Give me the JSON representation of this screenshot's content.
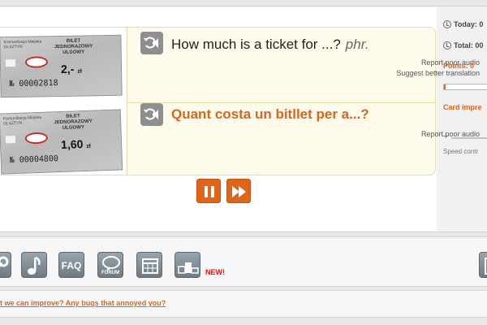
{
  "card": {
    "image_alt": "Bus ticket",
    "ticket_top": {
      "header": "Komunikacja Miejska OLSZTYN",
      "type": "BILET JEDNORAZOWY",
      "subtype": "ULGOWY",
      "price": "2,-",
      "price_unit": "zł",
      "number": "№ 00002818"
    },
    "ticket_bottom": {
      "header": "Komunikacja Miejska OLSZTYN",
      "type": "BILET JEDNORAZOWY",
      "subtype": "ULGOWY",
      "price": "1,60",
      "price_unit": "zł",
      "number": "№ 00004800"
    },
    "source_phrase": "How much is a ticket for ...?",
    "source_pos": "phr.",
    "target_phrase": "Quant costa un bitllet per a...?",
    "report_audio_label": "Report poor audio",
    "suggest_translation_label": "Suggest better translation",
    "report_audio_label_2": "Report poor audio"
  },
  "controls": {
    "pause_icon": "pause-icon",
    "fast_forward_icon": "fast-forward-icon"
  },
  "stats": {
    "today_label": "Today: 0",
    "total_label": "Total: 00",
    "points_label": "Points: 0",
    "progress_fraction": 0.03,
    "card_impr_label": "Card impre",
    "speed_prefix": "–",
    "speed_label": "Speed contr"
  },
  "toolbar": {
    "faq_label": "FAQ",
    "forum_label": "FORUM",
    "new_badge": "NEW!"
  },
  "footer": {
    "feedback_link": "t we can improve? Any bugs that annoyed you?"
  },
  "colors": {
    "accent": "#e0651a",
    "card_bg": "#fffbea",
    "link": "#d8641e",
    "new_badge": "#e01010"
  }
}
